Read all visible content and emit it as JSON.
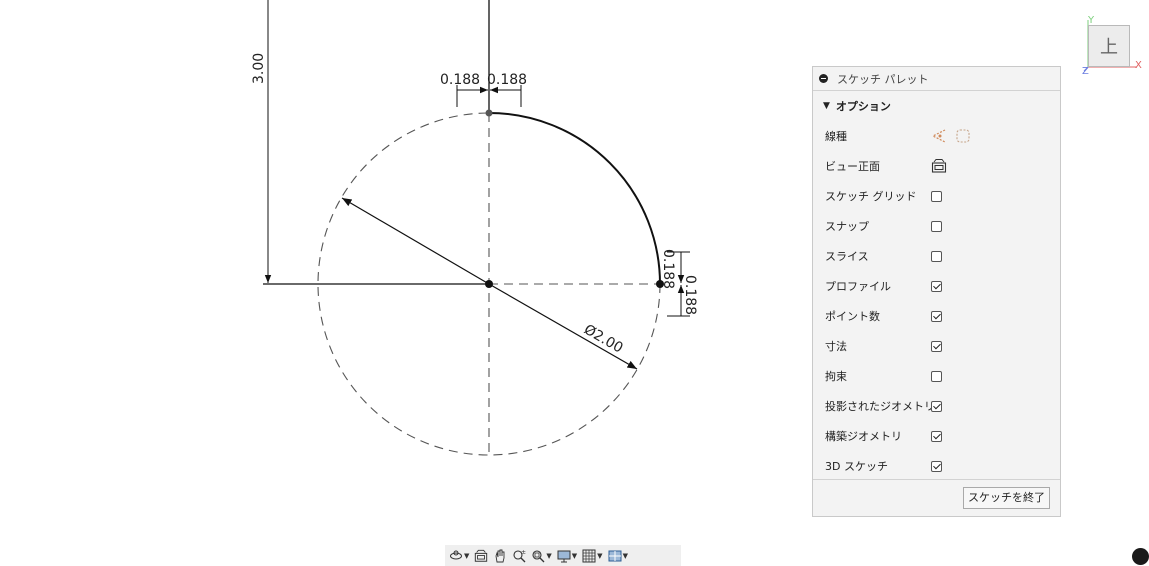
{
  "dimensions": {
    "vertical": "3.00",
    "top_left": "0.188",
    "top_right": "0.188",
    "right_upper": "0.188",
    "right_lower": "0.188",
    "diameter": "Ø2.00"
  },
  "palette": {
    "title": "スケッチ パレット",
    "section": "オプション",
    "rows": [
      {
        "label": "線種",
        "control": "linetype-icons"
      },
      {
        "label": "ビュー正面",
        "control": "look-at-icon"
      },
      {
        "label": "スケッチ グリッド",
        "checked": false
      },
      {
        "label": "スナップ",
        "checked": false
      },
      {
        "label": "スライス",
        "checked": false
      },
      {
        "label": "プロファイル",
        "checked": true
      },
      {
        "label": "ポイント数",
        "checked": true
      },
      {
        "label": "寸法",
        "checked": true
      },
      {
        "label": "拘束",
        "checked": false
      },
      {
        "label": "投影されたジオメトリ",
        "checked": true
      },
      {
        "label": "構築ジオメトリ",
        "checked": true
      },
      {
        "label": "3D スケッチ",
        "checked": true
      }
    ],
    "finish_label": "スケッチを終了"
  },
  "viewcube": {
    "face": "上",
    "axis_x": "X",
    "axis_y": "Y",
    "axis_z": "Z"
  },
  "navbar": {
    "icons": [
      "orbit-icon",
      "look-at-icon",
      "pan-icon",
      "zoom-icon",
      "fit-icon",
      "display-settings-icon",
      "grid-icon",
      "viewports-icon"
    ]
  }
}
